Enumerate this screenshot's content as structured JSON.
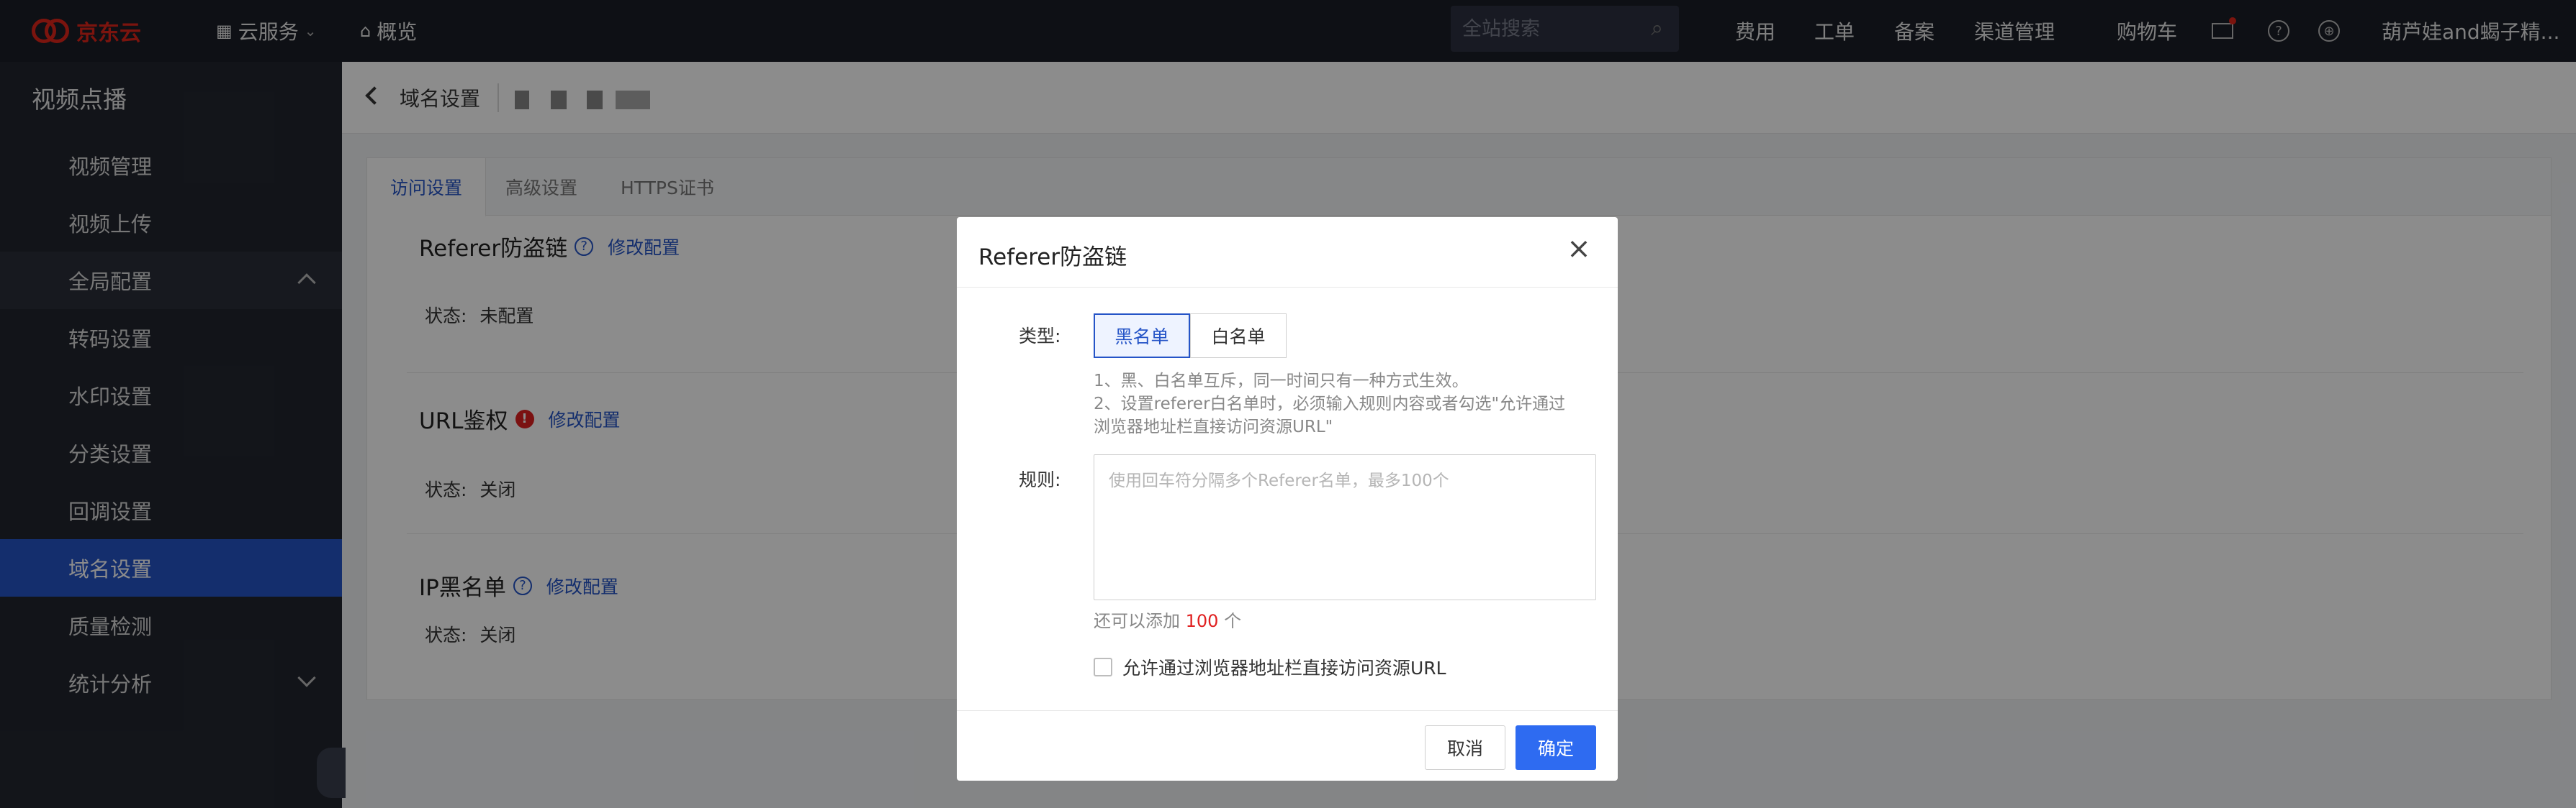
{
  "topnav": {
    "brand": "京东云",
    "cloud_services": "云服务",
    "overview": "概览",
    "search_placeholder": "全站搜索",
    "links": [
      "费用",
      "工单",
      "备案",
      "渠道管理",
      "购物车"
    ],
    "user": "葫芦娃and蝎子精..."
  },
  "sidebar": {
    "title": "视频点播",
    "items": [
      {
        "label": "视频管理"
      },
      {
        "label": "视频上传"
      },
      {
        "label": "全局配置"
      },
      {
        "label": "转码设置"
      },
      {
        "label": "水印设置"
      },
      {
        "label": "分类设置"
      },
      {
        "label": "回调设置"
      },
      {
        "label": "域名设置"
      },
      {
        "label": "质量检测"
      },
      {
        "label": "统计分析"
      }
    ],
    "active_label": "域名设置"
  },
  "header": {
    "title": "域名设置"
  },
  "tabs": [
    {
      "label": "访问设置"
    },
    {
      "label": "高级设置"
    },
    {
      "label": "HTTPS证书"
    }
  ],
  "sections": {
    "referer": {
      "title": "Referer防盗链",
      "edit": "修改配置",
      "status_label": "状态:",
      "status_value": "未配置"
    },
    "url_auth": {
      "title": "URL鉴权",
      "edit": "修改配置",
      "status_label": "状态:",
      "status_value": "关闭"
    },
    "ip_blacklist": {
      "title": "IP黑名单",
      "edit": "修改配置",
      "status_label": "状态:",
      "status_value": "关闭"
    }
  },
  "modal": {
    "title": "Referer防盗链",
    "type_label": "类型:",
    "type_options": [
      "黑名单",
      "白名单"
    ],
    "type_selected": "黑名单",
    "hint_lines": [
      "1、黑、白名单互斥，同一时间只有一种方式生效。",
      "2、设置referer白名单时，必须输入规则内容或者勾选\"允许通过",
      "浏览器地址栏直接访问资源URL\""
    ],
    "rule_label": "规则:",
    "rule_placeholder": "使用回车符分隔多个Referer名单，最多100个",
    "remain_prefix": "还可以添加",
    "remain_count": "100",
    "remain_suffix": "个",
    "allow_direct_label": "允许通过浏览器地址栏直接访问资源URL",
    "allow_direct_checked": false,
    "cancel": "取消",
    "confirm": "确定"
  }
}
